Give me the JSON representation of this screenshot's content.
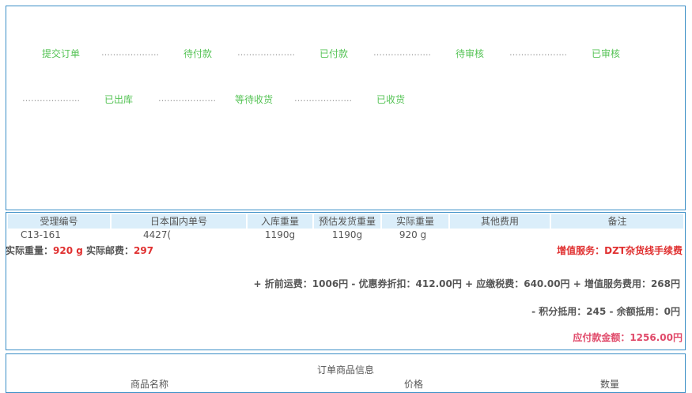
{
  "steps": {
    "row1": [
      "提交订单",
      "待付款",
      "已付款",
      "待审核",
      "已审核"
    ],
    "row2": [
      "已出库",
      "等待收货",
      "已收货"
    ],
    "separator": "……………….."
  },
  "table": {
    "headers": [
      "受理编号",
      "日本国内单号",
      "入库重量",
      "预估发货重量",
      "实际重量",
      "其他费用",
      "备注"
    ],
    "row": [
      "C13-161",
      "4427(",
      "1190g",
      "1190g",
      "920 g",
      "",
      ""
    ]
  },
  "summary": {
    "weight_label": "实际重量：",
    "weight_value": "920 g",
    "postage_label": " 实际邮费：",
    "postage_value": "297",
    "service": "增值服务：DZT杂货线手续费",
    "fees_line": "+ 折前运费：1006円 - 优惠券折扣：412.00円 + 应缴税费：640.00円 + 增值服务费用：268円",
    "deduct_line": "- 积分抵用：245 - 余额抵用：0円",
    "payable": "应付款金额：1256.00円"
  },
  "goods": {
    "title": "订单商品信息",
    "columns": [
      "商品名称",
      "价格",
      "数量"
    ]
  },
  "colors": {
    "step": "#55c355",
    "border": "#3a8ec6",
    "header_bg": "#dbeefa",
    "red": "#e03030",
    "pink": "#e04a6a"
  }
}
